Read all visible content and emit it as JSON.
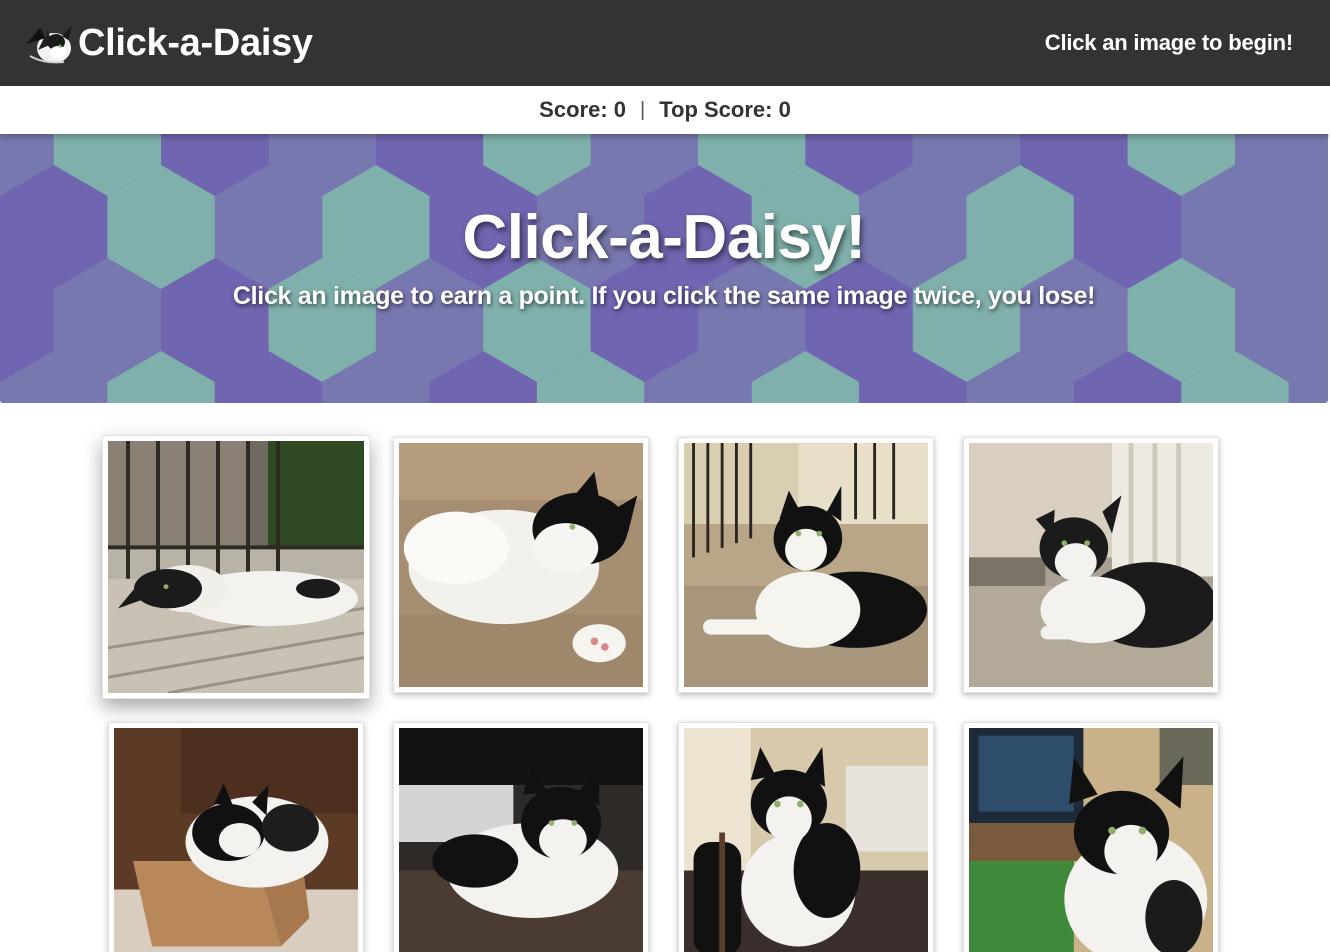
{
  "navbar": {
    "brand_title": "Click-a-Daisy",
    "logo_icon": "cat-logo-icon",
    "message": "Click an image to begin!"
  },
  "scoreboard": {
    "score_label": "Score: 0",
    "separator": "|",
    "top_score_label": "Top Score: 0",
    "score": 0,
    "top_score": 0
  },
  "hero": {
    "title": "Click-a-Daisy!",
    "subtitle": "Click an image to earn a point. If you click the same image twice, you lose!",
    "colors": {
      "purple": "#6f65b0",
      "teal": "#7fb0ab",
      "lavender": "#7878b0"
    }
  },
  "gallery": {
    "cards": [
      {
        "name": "cat-photo-1",
        "scene": "cat lying on sunny balcony"
      },
      {
        "name": "cat-photo-2",
        "scene": "cat lying on wooden floor"
      },
      {
        "name": "cat-photo-3",
        "scene": "cat lying on balcony near railing"
      },
      {
        "name": "cat-photo-4",
        "scene": "cat lying on carpet"
      },
      {
        "name": "cat-photo-5",
        "scene": "cat sitting in cardboard box"
      },
      {
        "name": "cat-photo-6",
        "scene": "cat on bed blanket"
      },
      {
        "name": "cat-photo-7",
        "scene": "cat sitting by guitar"
      },
      {
        "name": "cat-photo-8",
        "scene": "cat in front of monitor"
      }
    ]
  }
}
